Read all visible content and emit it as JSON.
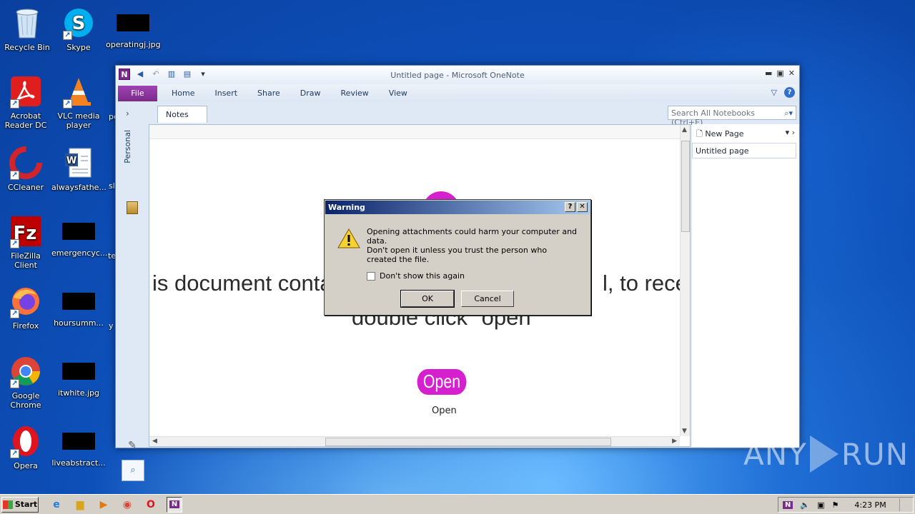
{
  "desktop": {
    "icons": [
      {
        "label": "Recycle Bin",
        "icon": "recycle-bin-icon"
      },
      {
        "label": "Skype",
        "icon": "skype-icon"
      },
      {
        "label": "operatingj.jpg",
        "icon": "image-file-icon"
      },
      {
        "label": "Acrobat Reader DC",
        "icon": "acrobat-icon"
      },
      {
        "label": "VLC media player",
        "icon": "vlc-icon"
      },
      {
        "label": "CCleaner",
        "icon": "ccleaner-icon"
      },
      {
        "label": "alwaysfathe...",
        "icon": "word-doc-icon"
      },
      {
        "label": "FileZilla Client",
        "icon": "filezilla-icon"
      },
      {
        "label": "emergencyc...",
        "icon": "image-file-icon"
      },
      {
        "label": "Firefox",
        "icon": "firefox-icon"
      },
      {
        "label": "hoursumm...",
        "icon": "image-file-icon"
      },
      {
        "label": "Google Chrome",
        "icon": "chrome-icon"
      },
      {
        "label": "itwhite.jpg",
        "icon": "image-file-icon"
      },
      {
        "label": "Opera",
        "icon": "opera-icon"
      },
      {
        "label": "liveabstract...",
        "icon": "image-file-icon"
      }
    ],
    "truncated_labels": [
      "pe",
      "sl",
      "te",
      "y"
    ]
  },
  "window": {
    "title": "Untitled page  -  Microsoft OneNote",
    "tabs": [
      "Home",
      "Insert",
      "Share",
      "Draw",
      "Review",
      "View"
    ],
    "file_tab": "File",
    "notebook": "Personal",
    "section_tab": "Notes",
    "search_placeholder": "Search All Notebooks (Ctrl+E)",
    "new_page": "New Page",
    "page_item": "Untitled page"
  },
  "page": {
    "line1_left": "is document contai",
    "line1_right": "l, to receiv",
    "line2": "double click \"open\"",
    "open_button": "Open",
    "open_caption": "Open",
    "accent_color": "#d61fcf"
  },
  "dialog": {
    "title": "Warning",
    "message1": "Opening attachments could harm your computer and data.",
    "message2": "Don't open it unless you trust the person who created the file.",
    "checkbox_label": "Don't show this again",
    "ok": "OK",
    "cancel": "Cancel"
  },
  "taskbar": {
    "start": "Start",
    "clock": "4:23 PM"
  },
  "watermark": {
    "left": "ANY",
    "right": "RUN"
  }
}
